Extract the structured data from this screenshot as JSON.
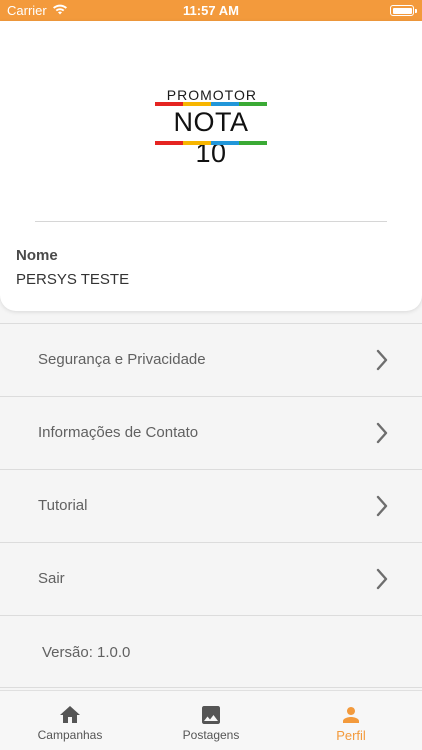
{
  "status_bar": {
    "carrier": "Carrier",
    "time": "11:57 AM"
  },
  "logo": {
    "top_text": "PROMOTOR",
    "main_text": "NOTA 10"
  },
  "profile": {
    "name_label": "Nome",
    "name_value": "PERSYS TESTE"
  },
  "menu": {
    "items": [
      {
        "label": "Segurança e Privacidade"
      },
      {
        "label": "Informações de Contato"
      },
      {
        "label": "Tutorial"
      },
      {
        "label": "Sair"
      }
    ],
    "version": "Versão: 1.0.0"
  },
  "tabs": [
    {
      "label": "Campanhas",
      "icon": "home-icon",
      "active": false
    },
    {
      "label": "Postagens",
      "icon": "image-icon",
      "active": false
    },
    {
      "label": "Perfil",
      "icon": "person-icon",
      "active": true
    }
  ],
  "colors": {
    "accent": "#f39a3c",
    "logo_red": "#e52421",
    "logo_yellow": "#f7b500",
    "logo_blue": "#2196d9",
    "logo_green": "#3aaa35"
  }
}
